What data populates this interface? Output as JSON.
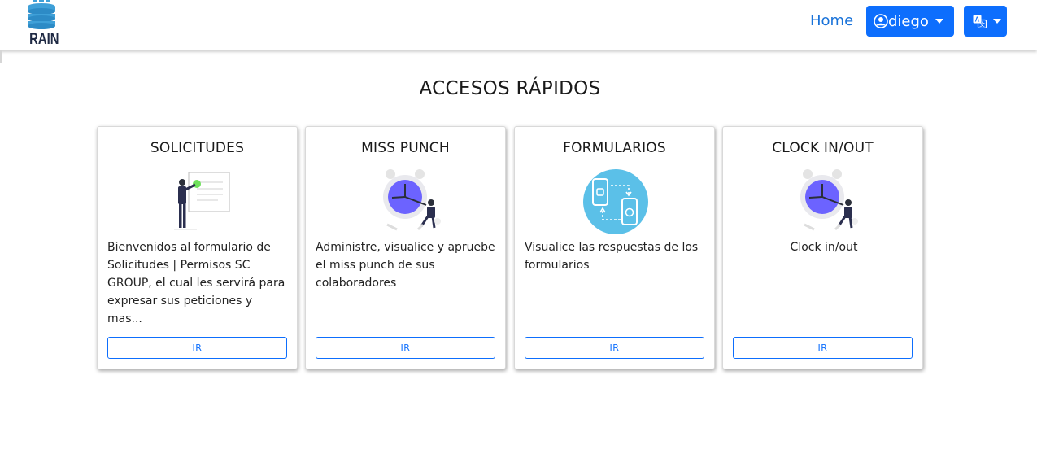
{
  "navbar": {
    "brand": "RAIN",
    "home_label": "Home",
    "user_label": "diego",
    "accent": "#0d6efd"
  },
  "page": {
    "title": "ACCESOS RÁPIDOS"
  },
  "cards": [
    {
      "title": "SOLICITUDES",
      "description": "Bienvenidos al formulario de Solicitudes | Permisos SC GROUP, el cual les servirá para expresar sus peticiones y mas...",
      "button": "IR",
      "icon": "presentation-illustration"
    },
    {
      "title": "MISS PUNCH",
      "description": "Administre, visualice y apruebe el miss punch de sus colaboradores",
      "button": "IR",
      "icon": "alarm-clock-illustration"
    },
    {
      "title": "FORMULARIOS",
      "description": "Visualice las respuestas de los formularios",
      "button": "IR",
      "icon": "phones-sync-illustration"
    },
    {
      "title": "CLOCK IN/OUT",
      "description": "Clock in/out",
      "button": "IR",
      "icon": "alarm-clock-illustration"
    }
  ]
}
